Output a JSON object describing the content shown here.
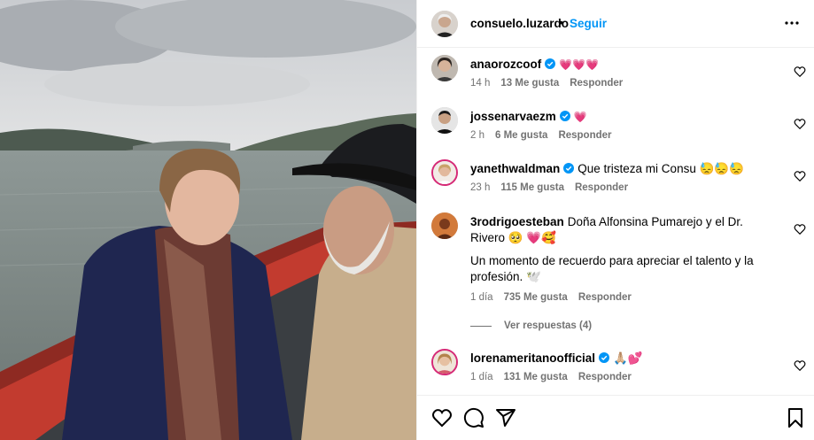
{
  "post": {
    "author": "consuelo.luzardo",
    "separator": "•",
    "follow_label": "Seguir",
    "options_icon": "more-horizontal-icon"
  },
  "comments": [
    {
      "username": "anaorozcoof",
      "verified": true,
      "text": "💗💗💗",
      "time": "14 h",
      "likes": "13 Me gusta",
      "reply_label": "Responder"
    },
    {
      "username": "jossenarvaezm",
      "verified": true,
      "text": "💗",
      "time": "2 h",
      "likes": "6 Me gusta",
      "reply_label": "Responder"
    },
    {
      "username": "yanethwaldman",
      "verified": true,
      "text": "Que tristeza mi Consu 😓😓😓",
      "time": "23 h",
      "likes": "115 Me gusta",
      "reply_label": "Responder"
    },
    {
      "username": "3rodrigoesteban",
      "verified": false,
      "text": "Doña Alfonsina Pumarejo y el Dr. Rivero 🥺 💗🥰",
      "text2": "Un momento de recuerdo para apreciar el talento y la profesión. 🕊️",
      "time": "1 día",
      "likes": "735 Me gusta",
      "reply_label": "Responder",
      "view_replies": "Ver respuestas (4)"
    },
    {
      "username": "lorenameritanoofficial",
      "verified": true,
      "text": "🙏🏼💕",
      "time": "1 día",
      "likes": "131 Me gusta",
      "reply_label": "Responder"
    }
  ],
  "actions": {
    "like_icon": "heart-icon",
    "comment_icon": "comment-icon",
    "share_icon": "send-icon",
    "save_icon": "bookmark-icon"
  },
  "colors": {
    "link_blue": "#0095f6",
    "verified_blue": "#0095f6",
    "meta_gray": "#737373",
    "divider": "#efefef"
  }
}
